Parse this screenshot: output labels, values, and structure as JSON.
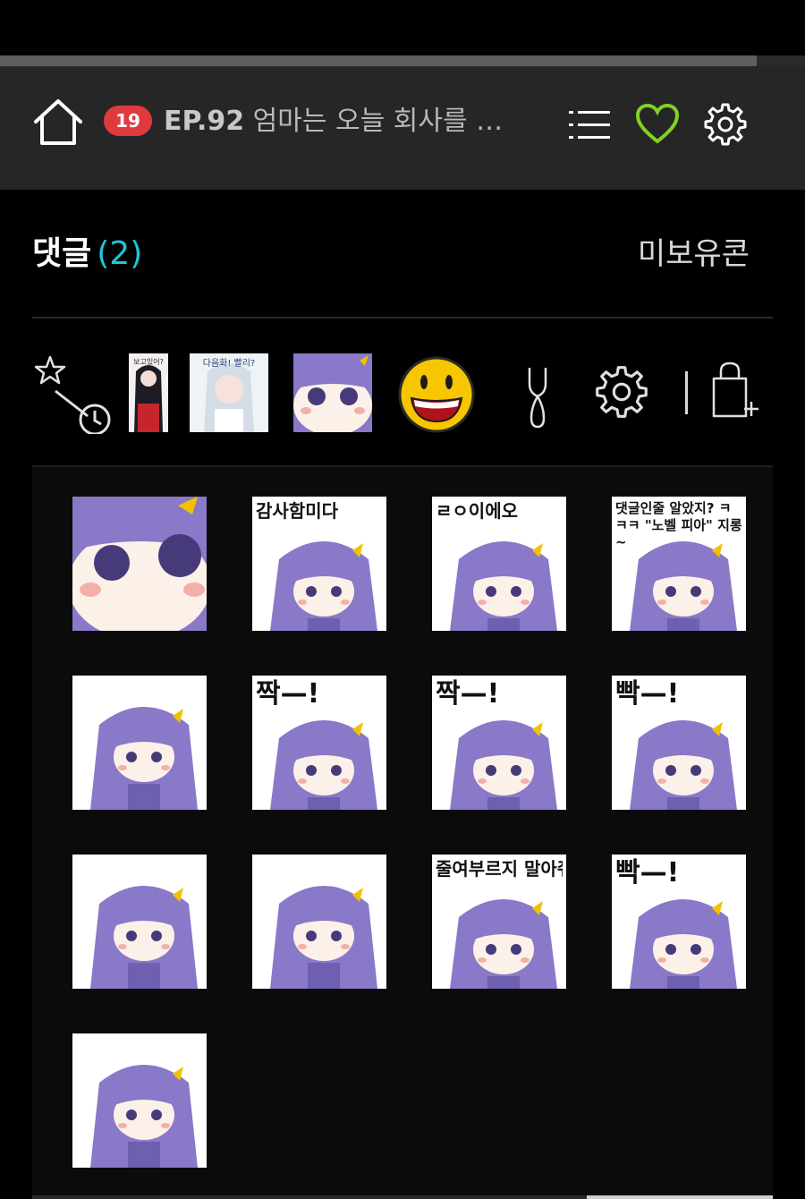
{
  "header": {
    "age_badge": "19",
    "episode_number": "EP.92",
    "episode_title": "엄마는 오늘 회사를 …",
    "reading_progress_percent": 94,
    "icons": [
      "home-icon",
      "list-icon",
      "heart-icon",
      "settings-icon"
    ]
  },
  "comments": {
    "label": "댓글",
    "count": "(2)",
    "unread_label": "미보유콘"
  },
  "sticker_tabs": {
    "items": [
      "recent-favorites-icon",
      "thumb-1",
      "thumb-2",
      "thumb-3",
      "emoji-icon",
      "fork-icon",
      "gear-icon",
      "shop-add-icon"
    ],
    "thumbs": [
      {
        "text": "보고있어?"
      },
      {
        "text": "다음화! 빨리?"
      },
      {
        "text": ""
      }
    ]
  },
  "stickers": [
    {
      "caption": ""
    },
    {
      "caption": "감사함미다"
    },
    {
      "caption": "ㄹㅇ이에오"
    },
    {
      "caption": "댓글인줄 알았지? ㅋㅋㅋ \"노벨 피아\" 지롱~"
    },
    {
      "caption": ""
    },
    {
      "caption": "짝—!"
    },
    {
      "caption": "짝—!"
    },
    {
      "caption": "빡—!"
    },
    {
      "caption": ""
    },
    {
      "caption": ""
    },
    {
      "caption": "줄여부르지 말아줘..."
    },
    {
      "caption": "빡—!"
    },
    {
      "caption": ""
    }
  ],
  "colors": {
    "accent_count": "#1ec6d6",
    "badge": "#e03a3e",
    "heart": "#7ed321",
    "character_purple": "#8a78c8"
  }
}
